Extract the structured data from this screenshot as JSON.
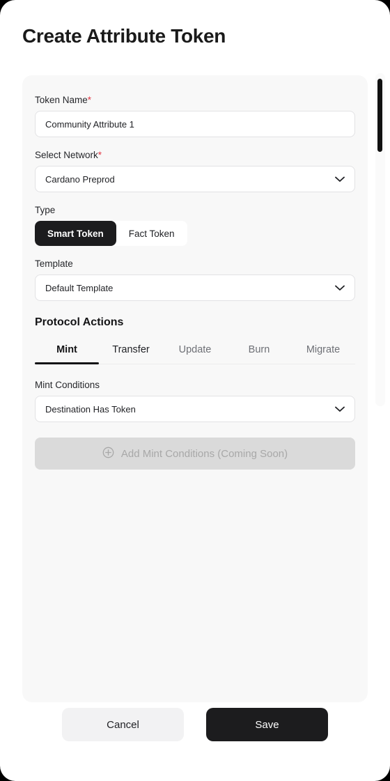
{
  "page": {
    "title": "Create Attribute Token"
  },
  "form": {
    "token_name": {
      "label": "Token Name",
      "required_marker": "*",
      "value": "Community Attribute 1",
      "placeholder": "Token Name"
    },
    "select_network": {
      "label": "Select Network",
      "required_marker": "*",
      "value": "Cardano Preprod",
      "icon": "chevron-down-icon"
    },
    "type": {
      "label": "Type",
      "options": [
        {
          "label": "Smart Token",
          "selected": true
        },
        {
          "label": "Fact Token",
          "selected": false
        }
      ]
    },
    "template": {
      "label": "Template",
      "value": "Default Template",
      "icon": "chevron-down-icon"
    }
  },
  "protocol_actions": {
    "heading": "Protocol Actions",
    "tabs": [
      {
        "label": "Mint",
        "state": "current"
      },
      {
        "label": "Transfer",
        "state": "dark"
      },
      {
        "label": "Update",
        "state": "muted"
      },
      {
        "label": "Burn",
        "state": "muted"
      },
      {
        "label": "Migrate",
        "state": "muted"
      }
    ],
    "mint_conditions": {
      "label": "Mint Conditions",
      "value": "Destination Has Token",
      "icon": "chevron-down-icon"
    },
    "add_conditions": {
      "label": "Add Mint Conditions (Coming Soon)",
      "icon": "plus-circle-icon",
      "disabled": true
    }
  },
  "footer": {
    "cancel_label": "Cancel",
    "save_label": "Save"
  },
  "colors": {
    "accent_dark": "#1c1c1e",
    "required_red": "#e23744",
    "card_bg": "#f8f8f8",
    "muted_text": "#6e7076"
  }
}
